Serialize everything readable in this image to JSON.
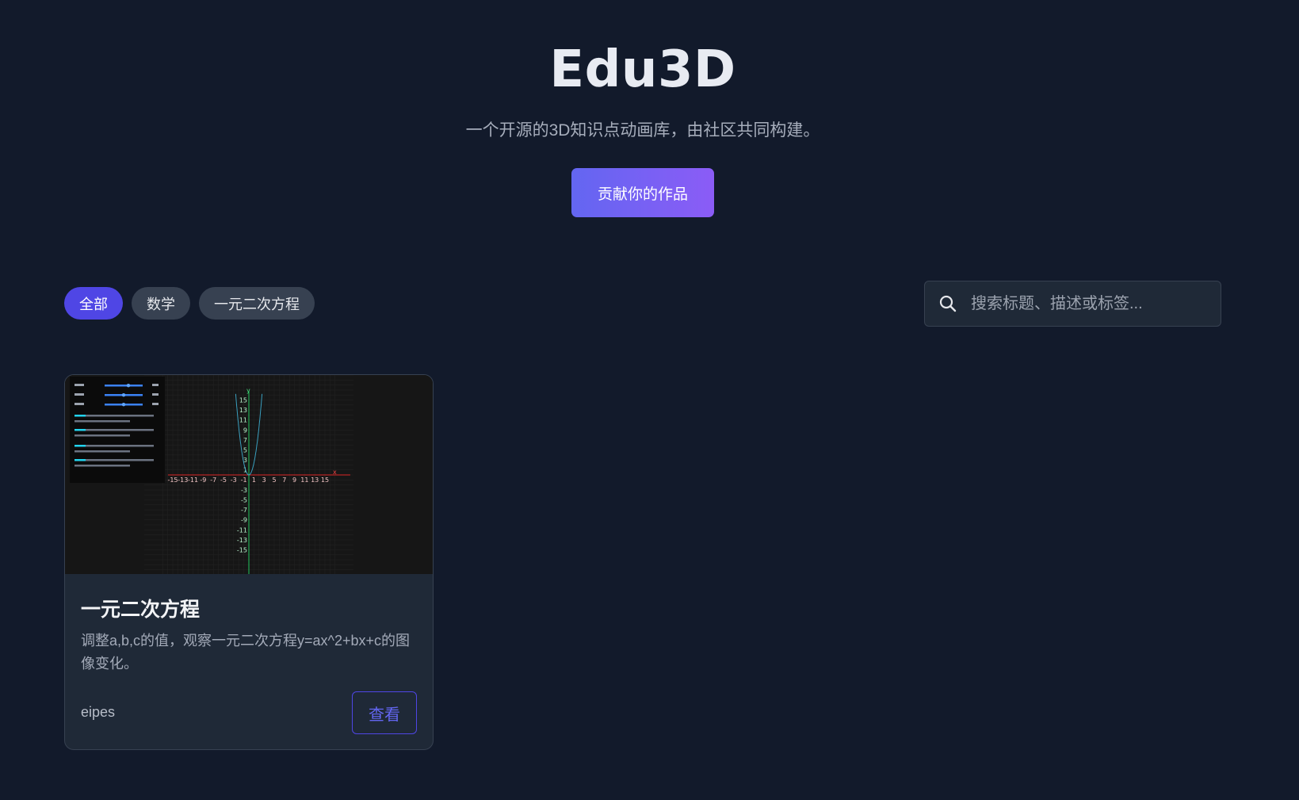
{
  "hero": {
    "title": "Edu3D",
    "subtitle": "一个开源的3D知识点动画库，由社区共同构建。",
    "cta_label": "贡献你的作品"
  },
  "filters": [
    {
      "label": "全部",
      "active": true
    },
    {
      "label": "数学",
      "active": false
    },
    {
      "label": "一元二次方程",
      "active": false
    }
  ],
  "search": {
    "placeholder": "搜索标题、描述或标签...",
    "icon": "search-icon"
  },
  "cards": [
    {
      "title": "一元二次方程",
      "description": "调整a,b,c的值，观察一元二次方程y=ax^2+bx+c的图像变化。",
      "author": "eipes",
      "view_label": "查看",
      "thumbnail": {
        "y_ticks": [
          "15",
          "13",
          "11",
          "9",
          "7",
          "5",
          "3",
          "1",
          "-1",
          "-3",
          "-5",
          "-7",
          "-9",
          "-11",
          "-13",
          "-15"
        ],
        "x_ticks": [
          "-15",
          "-13",
          "-11",
          "-9",
          "-7",
          "-5",
          "-3",
          "-1",
          "1",
          "3",
          "5",
          "7",
          "9",
          "11",
          "13",
          "15"
        ],
        "axis_x_label": "x",
        "axis_y_label": "y"
      }
    }
  ],
  "colors": {
    "background": "#121a2b",
    "accent": "#4f46e5",
    "cta_gradient_start": "#6366f1",
    "cta_gradient_end": "#8b5cf6"
  }
}
